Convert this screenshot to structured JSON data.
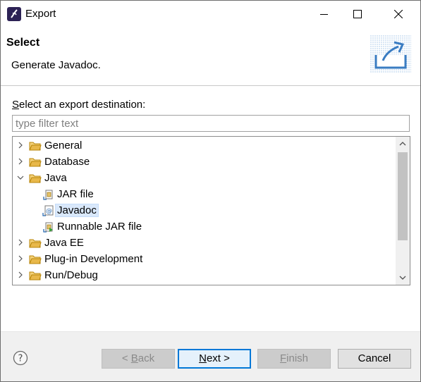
{
  "window": {
    "title": "Export"
  },
  "header": {
    "title": "Select",
    "description": "Generate Javadoc."
  },
  "body": {
    "destination_label_mnemonic": "S",
    "destination_label_rest": "elect an export destination:",
    "filter_placeholder": "type filter text",
    "filter_value": ""
  },
  "tree": {
    "items": [
      {
        "label": "General",
        "expanded": false,
        "icon": "folder-icon"
      },
      {
        "label": "Database",
        "expanded": false,
        "icon": "folder-icon"
      },
      {
        "label": "Java",
        "expanded": true,
        "icon": "folder-open-icon",
        "children": [
          {
            "label": "JAR file",
            "icon": "jar-file-icon"
          },
          {
            "label": "Javadoc",
            "icon": "javadoc-icon",
            "selected": true
          },
          {
            "label": "Runnable JAR file",
            "icon": "runnable-jar-icon"
          }
        ]
      },
      {
        "label": "Java EE",
        "expanded": false,
        "icon": "folder-icon"
      },
      {
        "label": "Plug-in Development",
        "expanded": false,
        "icon": "folder-icon"
      },
      {
        "label": "Run/Debug",
        "expanded": false,
        "icon": "folder-icon"
      }
    ]
  },
  "footer": {
    "back": {
      "prefix": "< ",
      "mnemonic": "B",
      "rest": "ack",
      "enabled": false
    },
    "next": {
      "mnemonic": "N",
      "rest": "ext >",
      "enabled": true
    },
    "finish": {
      "mnemonic": "F",
      "rest": "inish",
      "enabled": false
    },
    "cancel": {
      "label": "Cancel",
      "enabled": true
    }
  },
  "colors": {
    "accent": "#0078d7",
    "selection": "#d9e8fb",
    "folder": "#e8b84a"
  }
}
